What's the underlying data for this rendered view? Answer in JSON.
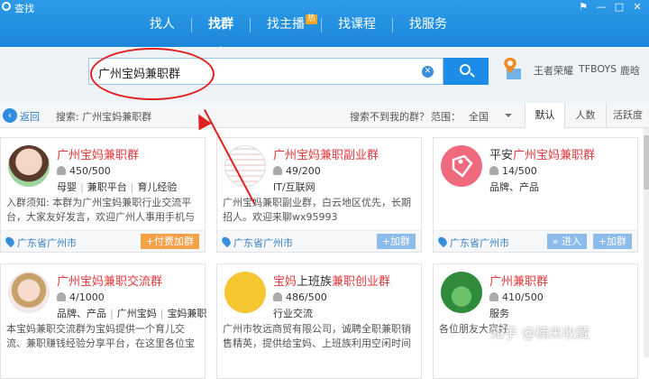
{
  "window": {
    "title": "查找",
    "controls": [
      "⚑",
      "—",
      "□",
      "✕"
    ]
  },
  "tabs": [
    {
      "label": "找人",
      "active": false
    },
    {
      "label": "找群",
      "active": true
    },
    {
      "label": "找主播",
      "active": false,
      "badge": "热"
    },
    {
      "label": "找课程",
      "active": false
    },
    {
      "label": "找服务",
      "active": false
    }
  ],
  "search": {
    "value": "广州宝妈兼职群",
    "clear_icon": "clear-icon",
    "button_icon": "search-icon"
  },
  "hotwords": [
    "王者荣耀",
    "TFBOYS",
    "鹿晗"
  ],
  "filterbar": {
    "back_label": "返回",
    "search_label": "搜索: 广州宝妈兼职群",
    "no_find": "搜索不到我的群？",
    "range_label": "范围：",
    "range_value": "全国",
    "sort_tabs": [
      {
        "label": "默认",
        "active": true
      },
      {
        "label": "人数",
        "active": false
      },
      {
        "label": "活跃度",
        "active": false
      }
    ]
  },
  "cards": [
    {
      "name_parts": [
        "广州宝妈兼职群"
      ],
      "count": "450/500",
      "tags": [
        "母婴",
        "兼职平台",
        "育儿经验"
      ],
      "desc": "入群须知: 本群为广州宝妈兼职行业交流平台，大家友好发言，欢迎广州人事用手机与电脑兼职行",
      "location": "广东省广州市",
      "buttons": [
        "+付费加群"
      ]
    },
    {
      "name_parts": [
        "广州宝妈兼职副业群"
      ],
      "count": "49/200",
      "tags": [
        "IT/互联网"
      ],
      "desc": "广州宝妈兼职副业群，白云地区优先，长期招人。欢迎来聊wx95993",
      "location": "广东省广州市",
      "buttons": [
        "+加群"
      ]
    },
    {
      "name_parts": [
        "平安",
        "广州宝妈兼职群"
      ],
      "count": "14/500",
      "tags": [
        "品牌、产品"
      ],
      "desc": "",
      "location": "广东省广州市",
      "buttons": [
        "» 进入",
        "+加群"
      ]
    },
    {
      "name_parts": [
        "广州宝妈兼职交流群"
      ],
      "count": "4/1000",
      "tags": [
        "品牌、产品",
        "广州宝妈",
        "宝妈兼职"
      ],
      "desc": "本宝妈兼职交流群为宝妈提供一个育儿交流、兼职赚钱经验分享平台，在这里各位宝妈既可以交流",
      "location": "",
      "buttons": []
    },
    {
      "name_parts": [
        "宝妈",
        "上班族",
        "兼职创业群"
      ],
      "count": "486/500",
      "tags": [
        "行业交流"
      ],
      "desc": "广州市牧远商贸有限公司，诚聘全职兼职销售精英，提供给宝妈、上班族利用空闲时间赚钱机",
      "location": "",
      "buttons": []
    },
    {
      "name_parts": [
        "广州兼职群"
      ],
      "count": "410/500",
      "tags": [
        "服务"
      ],
      "desc": "各位朋友大家好",
      "location": "",
      "buttons": []
    }
  ],
  "watermark": "知乎 @楠来收藏",
  "colors": {
    "accent": "#1b86d9",
    "highlight": "#e4393c",
    "annotation": "#e02020"
  }
}
